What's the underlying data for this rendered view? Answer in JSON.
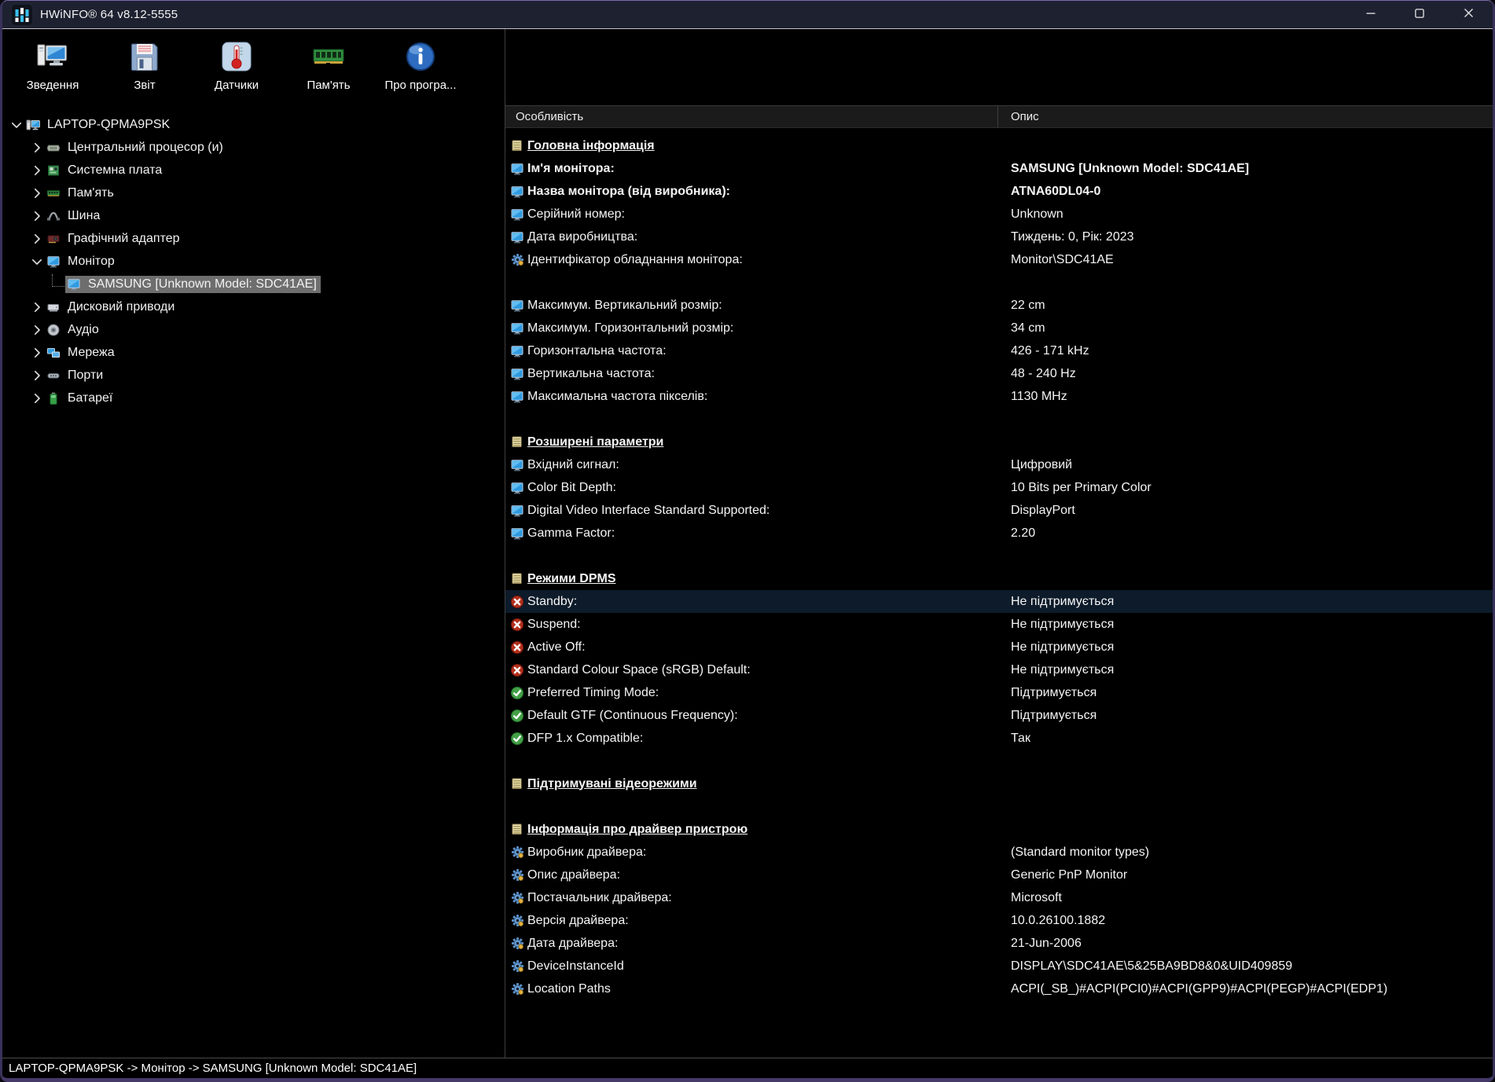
{
  "titlebar": {
    "title": "HWiNFO® 64 v8.12-5555",
    "app_icon": "hwinfo-logo-icon",
    "controls": {
      "minimize": "minimize",
      "maximize": "maximize",
      "close": "close"
    }
  },
  "toolbar": {
    "buttons": [
      {
        "label": "Зведення",
        "icon": "computer-summary-icon"
      },
      {
        "label": "Звіт",
        "icon": "report-floppy-icon"
      },
      {
        "label": "Датчики",
        "icon": "sensors-thermometer-icon"
      },
      {
        "label": "Пам'ять",
        "icon": "memory-ram-icon"
      },
      {
        "label": "Про програ...",
        "icon": "about-info-icon"
      }
    ]
  },
  "tree": {
    "items": [
      {
        "label": "LAPTOP-QPMA9PSK",
        "level": 0,
        "icon": "computer-icon",
        "expander": "expanded",
        "selected": false
      },
      {
        "label": "Центральний процесор (и)",
        "level": 1,
        "icon": "cpu-icon",
        "expander": "collapsed",
        "selected": false
      },
      {
        "label": "Системна плата",
        "level": 1,
        "icon": "motherboard-icon",
        "expander": "collapsed",
        "selected": false
      },
      {
        "label": "Пам'ять",
        "level": 1,
        "icon": "memory-icon",
        "expander": "collapsed",
        "selected": false
      },
      {
        "label": "Шина",
        "level": 1,
        "icon": "bus-icon",
        "expander": "collapsed",
        "selected": false
      },
      {
        "label": "Графічний адаптер",
        "level": 1,
        "icon": "gpu-icon",
        "expander": "collapsed",
        "selected": false
      },
      {
        "label": "Монітор",
        "level": 1,
        "icon": "monitor-icon",
        "expander": "expanded",
        "selected": false
      },
      {
        "label": "SAMSUNG [Unknown Model: SDC41AE]",
        "level": 2,
        "icon": "monitor-icon",
        "expander": "none",
        "selected": true
      },
      {
        "label": "Дисковий приводи",
        "level": 1,
        "icon": "disk-icon",
        "expander": "collapsed",
        "selected": false
      },
      {
        "label": "Аудіо",
        "level": 1,
        "icon": "audio-icon",
        "expander": "collapsed",
        "selected": false
      },
      {
        "label": "Мережа",
        "level": 1,
        "icon": "network-icon",
        "expander": "collapsed",
        "selected": false
      },
      {
        "label": "Порти",
        "level": 1,
        "icon": "ports-icon",
        "expander": "collapsed",
        "selected": false
      },
      {
        "label": "Батареї",
        "level": 1,
        "icon": "battery-icon",
        "expander": "collapsed",
        "selected": false
      }
    ]
  },
  "list": {
    "columns": [
      "Особливість",
      "Опис"
    ],
    "rows": [
      {
        "type": "section",
        "icon": "section-pages-icon",
        "label": "Головна інформація"
      },
      {
        "type": "item",
        "icon": "monitor-icon",
        "label": "Ім'я монітора:",
        "value": "SAMSUNG [Unknown Model: SDC41AE]",
        "bold": true
      },
      {
        "type": "item",
        "icon": "monitor-icon",
        "label": "Назва монітора (від виробника):",
        "value": "ATNA60DL04-0",
        "bold": true
      },
      {
        "type": "item",
        "icon": "monitor-icon",
        "label": "Серійний номер:",
        "value": "Unknown"
      },
      {
        "type": "item",
        "icon": "monitor-icon",
        "label": "Дата виробництва:",
        "value": "Тиждень: 0, Рік: 2023"
      },
      {
        "type": "item",
        "icon": "driver-gear-icon",
        "label": "Ідентифікатор обладнання монітора:",
        "value": "Monitor\\SDC41AE"
      },
      {
        "type": "blank"
      },
      {
        "type": "item",
        "icon": "monitor-icon",
        "label": "Максимум. Вертикальний розмір:",
        "value": "22 cm"
      },
      {
        "type": "item",
        "icon": "monitor-icon",
        "label": "Максимум. Горизонтальний розмір:",
        "value": "34 cm"
      },
      {
        "type": "item",
        "icon": "monitor-icon",
        "label": "Горизонтальна частота:",
        "value": "426 - 171 kHz"
      },
      {
        "type": "item",
        "icon": "monitor-icon",
        "label": "Вертикальна частота:",
        "value": "48 - 240 Hz"
      },
      {
        "type": "item",
        "icon": "monitor-icon",
        "label": "Максимальна частота пікселів:",
        "value": "1130 MHz"
      },
      {
        "type": "blank"
      },
      {
        "type": "section",
        "icon": "section-pages-icon",
        "label": "Розширені параметри"
      },
      {
        "type": "item",
        "icon": "monitor-icon",
        "label": "Вхідний сигнал:",
        "value": "Цифровий"
      },
      {
        "type": "item",
        "icon": "monitor-icon",
        "label": "Color Bit Depth:",
        "value": "10 Bits per Primary Color"
      },
      {
        "type": "item",
        "icon": "monitor-icon",
        "label": "Digital Video Interface Standard Supported:",
        "value": "DisplayPort"
      },
      {
        "type": "item",
        "icon": "monitor-icon",
        "label": "Gamma Factor:",
        "value": "2.20"
      },
      {
        "type": "blank"
      },
      {
        "type": "section",
        "icon": "section-pages-icon",
        "label": "Режими DPMS"
      },
      {
        "type": "item",
        "icon": "unsupported-icon",
        "label": "Standby:",
        "value": "Не підтримується",
        "highlighted": true
      },
      {
        "type": "item",
        "icon": "unsupported-icon",
        "label": "Suspend:",
        "value": "Не підтримується"
      },
      {
        "type": "item",
        "icon": "unsupported-icon",
        "label": "Active Off:",
        "value": "Не підтримується"
      },
      {
        "type": "item",
        "icon": "unsupported-icon",
        "label": "Standard Colour Space (sRGB) Default:",
        "value": "Не підтримується"
      },
      {
        "type": "item",
        "icon": "supported-icon",
        "label": "Preferred Timing Mode:",
        "value": "Підтримується"
      },
      {
        "type": "item",
        "icon": "supported-icon",
        "label": "Default GTF (Continuous Frequency):",
        "value": "Підтримується"
      },
      {
        "type": "item",
        "icon": "supported-icon",
        "label": "DFP 1.x Compatible:",
        "value": "Так"
      },
      {
        "type": "blank"
      },
      {
        "type": "section",
        "icon": "section-pages-icon",
        "label": "Підтримувані відеорежими"
      },
      {
        "type": "blank"
      },
      {
        "type": "section",
        "icon": "section-pages-icon",
        "label": "Інформація про драйвер пристрою"
      },
      {
        "type": "item",
        "icon": "driver-gear-icon",
        "label": "Виробник драйвера:",
        "value": "(Standard monitor types)"
      },
      {
        "type": "item",
        "icon": "driver-gear-icon",
        "label": "Опис драйвера:",
        "value": "Generic PnP Monitor"
      },
      {
        "type": "item",
        "icon": "driver-gear-icon",
        "label": "Постачальник драйвера:",
        "value": "Microsoft"
      },
      {
        "type": "item",
        "icon": "driver-gear-icon",
        "label": "Версія драйвера:",
        "value": "10.0.26100.1882"
      },
      {
        "type": "item",
        "icon": "driver-gear-icon",
        "label": "Дата драйвера:",
        "value": "21-Jun-2006"
      },
      {
        "type": "item",
        "icon": "driver-gear-icon",
        "label": "DeviceInstanceId",
        "value": "DISPLAY\\SDC41AE\\5&25BA9BD8&0&UID409859"
      },
      {
        "type": "item",
        "icon": "driver-gear-icon",
        "label": "Location Paths",
        "value": "ACPI(_SB_)#ACPI(PCI0)#ACPI(GPP9)#ACPI(PEGP)#ACPI(EDP1)"
      }
    ]
  },
  "statusbar": {
    "path": "LAPTOP-QPMA9PSK -> Монітор -> SAMSUNG [Unknown Model: SDC41AE]"
  },
  "colors": {
    "titlebar_bg": "#1e2130",
    "panel_bg": "#000000",
    "tree_selection_gray": "#6e6e6e",
    "row_highlight_navy": "#0d1b2a",
    "supported_green": "#43a047",
    "unsupported_red": "#b3301c",
    "monitor_blue": "#2f9ae0",
    "section_icon_yellow": "#efe3b0",
    "window_border_purple": "#453a68"
  }
}
